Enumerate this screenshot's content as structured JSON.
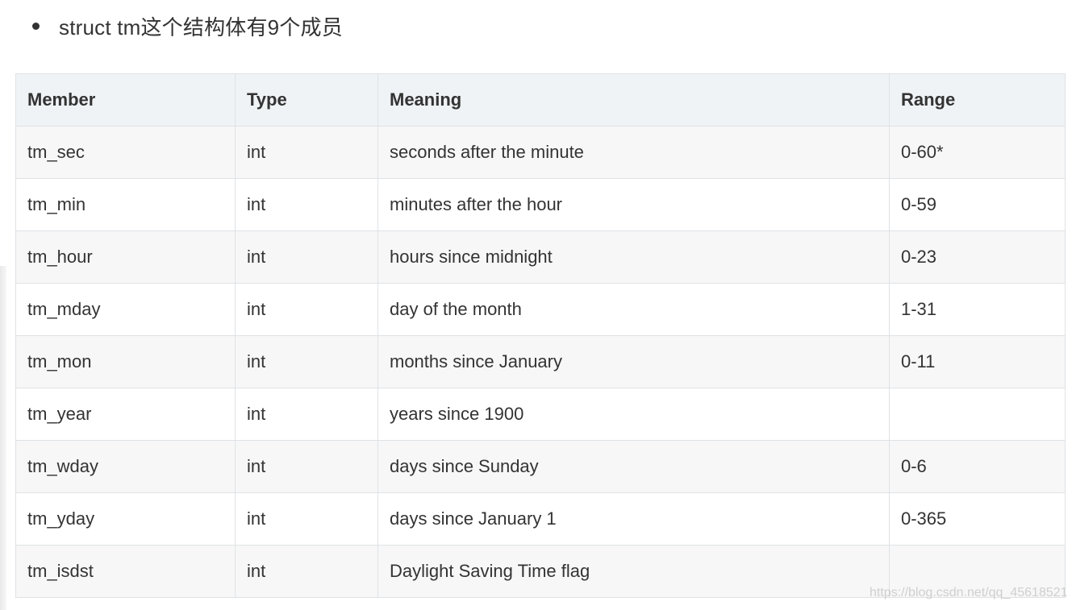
{
  "intro": {
    "text": "struct tm这个结构体有9个成员"
  },
  "table": {
    "headers": [
      "Member",
      "Type",
      "Meaning",
      "Range"
    ],
    "rows": [
      {
        "member": "tm_sec",
        "type": "int",
        "meaning": "seconds after the minute",
        "range": "0-60*"
      },
      {
        "member": "tm_min",
        "type": "int",
        "meaning": "minutes after the hour",
        "range": "0-59"
      },
      {
        "member": "tm_hour",
        "type": "int",
        "meaning": "hours since midnight",
        "range": "0-23"
      },
      {
        "member": "tm_mday",
        "type": "int",
        "meaning": "day of the month",
        "range": "1-31"
      },
      {
        "member": "tm_mon",
        "type": "int",
        "meaning": "months since January",
        "range": "0-11"
      },
      {
        "member": "tm_year",
        "type": "int",
        "meaning": "years since 1900",
        "range": ""
      },
      {
        "member": "tm_wday",
        "type": "int",
        "meaning": "days since Sunday",
        "range": "0-6"
      },
      {
        "member": "tm_yday",
        "type": "int",
        "meaning": "days since January 1",
        "range": "0-365"
      },
      {
        "member": "tm_isdst",
        "type": "int",
        "meaning": "Daylight Saving Time flag",
        "range": ""
      }
    ]
  },
  "watermark": {
    "text": "https://blog.csdn.net/qq_45618521"
  }
}
